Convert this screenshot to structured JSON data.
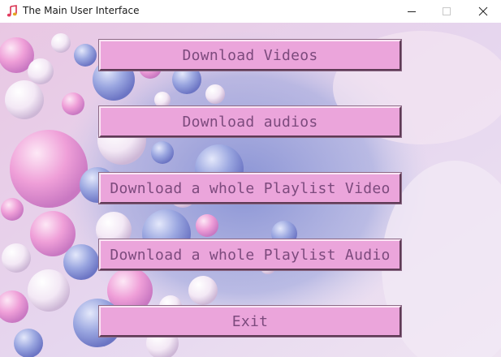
{
  "window": {
    "title": "The Main User Interface",
    "app_icon": "music-note-icon",
    "controls": {
      "minimize_icon": "minimize-icon",
      "maximize_icon": "maximize-icon",
      "close_icon": "close-icon"
    }
  },
  "buttons": {
    "download_videos": "Download Videos",
    "download_audios": "Download audios",
    "download_playlist_video": "Download a whole Playlist Video",
    "download_playlist_audio": "Download a whole Playlist Audio",
    "exit": "Exit"
  },
  "colors": {
    "button_face": "#eba5db",
    "button_text": "#7c4a7d",
    "background_accent_pink": "#f0a7dc",
    "background_accent_blue": "#8f99d6"
  }
}
